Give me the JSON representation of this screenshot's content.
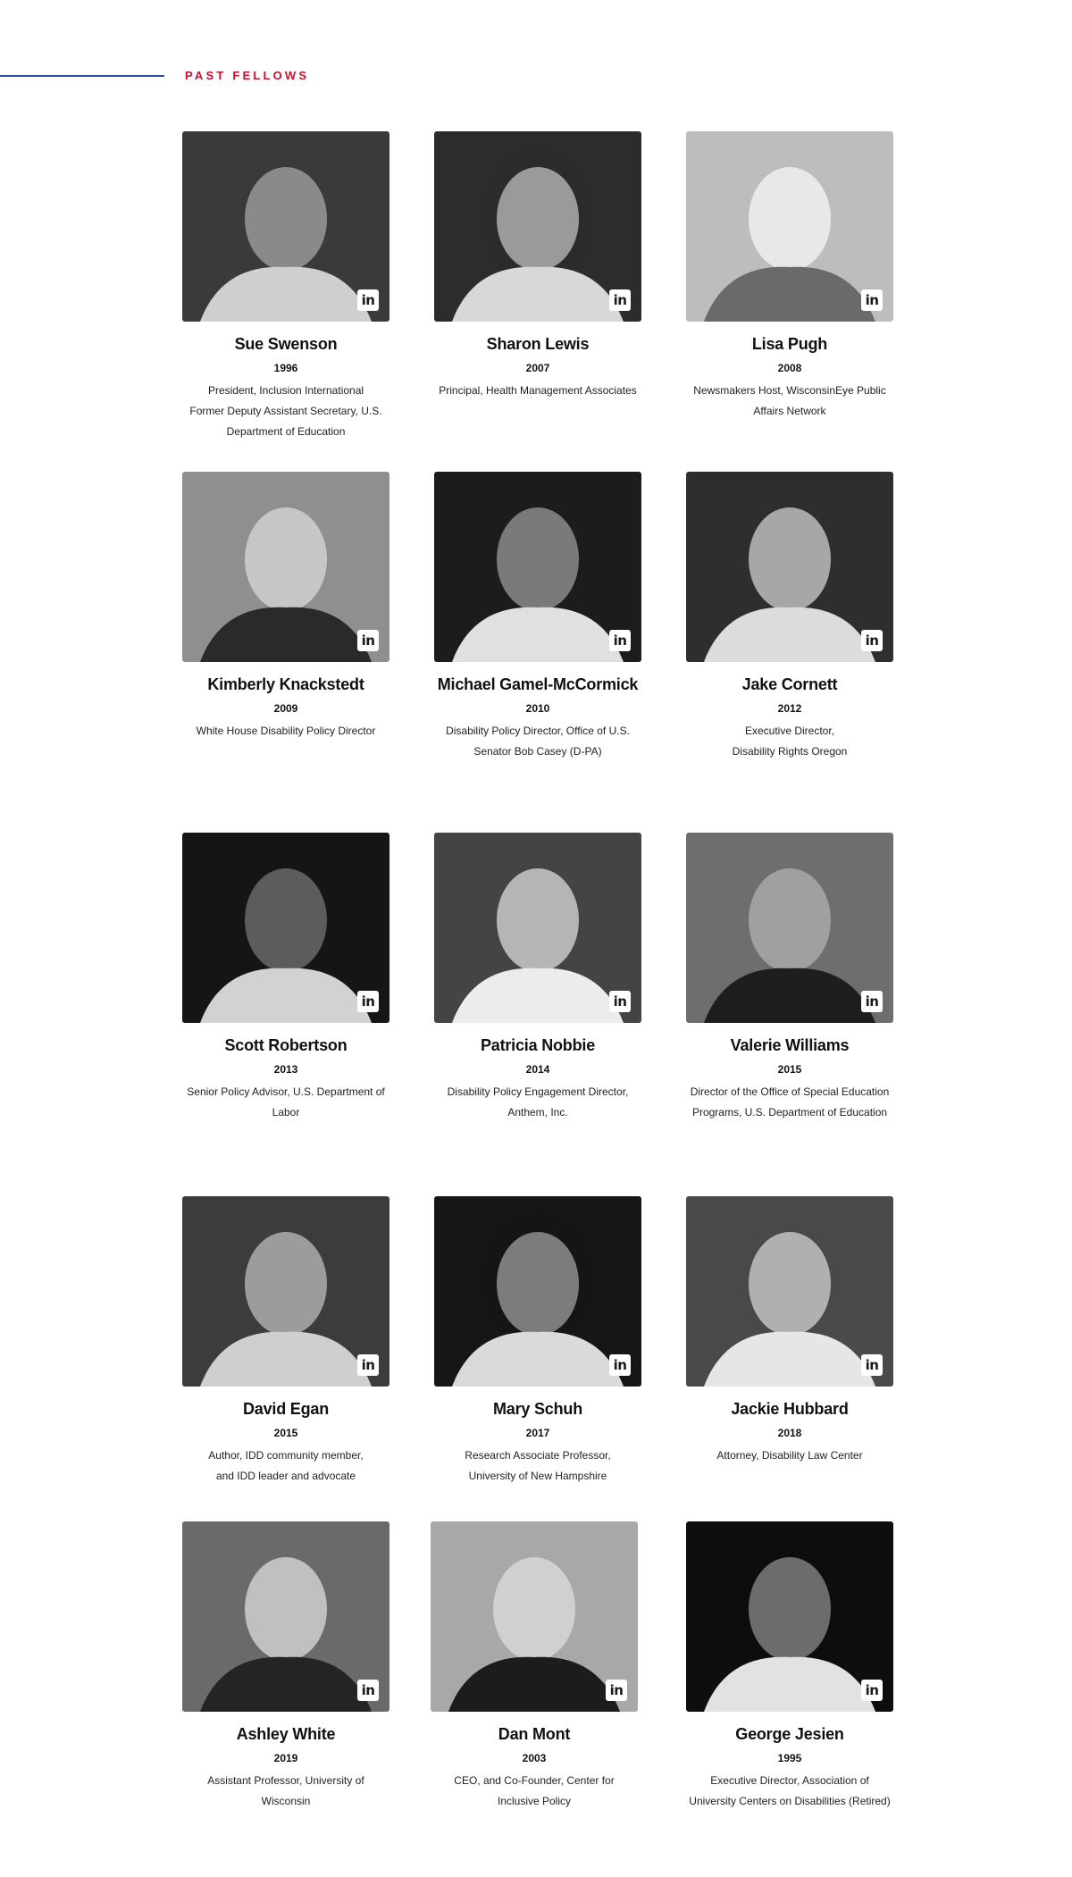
{
  "section": {
    "title": "PAST FELLOWS",
    "accent_color": "#c8102e",
    "line_color": "#2b4aa0"
  },
  "social_icon": {
    "name": "linkedin-icon",
    "glyph": "in"
  },
  "fellows": [
    {
      "name": "Sue Swenson",
      "year": "1996",
      "role": [
        "President, Inclusion International",
        "Former Deputy Assistant Secretary, U.S.",
        "Department of Education"
      ]
    },
    {
      "name": "Sharon Lewis",
      "year": "2007",
      "role": [
        "Principal, Health Management Associates"
      ]
    },
    {
      "name": "Lisa Pugh",
      "year": "2008",
      "role": [
        "Newsmakers Host, WisconsinEye Public",
        "Affairs Network"
      ]
    },
    {
      "name": "Kimberly Knackstedt",
      "year": "2009",
      "role": [
        "White House Disability Policy Director"
      ]
    },
    {
      "name": "Michael Gamel-McCormick",
      "year": "2010",
      "role": [
        "Disability Policy Director, Office of U.S.",
        "Senator Bob Casey (D-PA)"
      ]
    },
    {
      "name": "Jake Cornett",
      "year": "2012",
      "role": [
        "Executive Director,",
        "Disability Rights Oregon"
      ]
    },
    {
      "name": "Scott Robertson",
      "year": "2013",
      "role": [
        "Senior Policy Advisor, U.S. Department of",
        "Labor"
      ]
    },
    {
      "name": "Patricia Nobbie",
      "year": "2014",
      "role": [
        "Disability Policy Engagement Director,",
        "Anthem, Inc."
      ]
    },
    {
      "name": "Valerie Williams",
      "year": "2015",
      "role": [
        "Director of the Office of Special Education",
        "Programs, U.S. Department of Education"
      ]
    },
    {
      "name": "David Egan",
      "year": "2015",
      "role": [
        "Author, IDD community member,",
        "and IDD leader and advocate"
      ]
    },
    {
      "name": "Mary Schuh",
      "year": "2017",
      "role": [
        "Research Associate Professor,",
        "University of New Hampshire"
      ]
    },
    {
      "name": "Jackie Hubbard",
      "year": "2018",
      "role": [
        "Attorney, Disability Law Center"
      ]
    },
    {
      "name": "Ashley White",
      "year": "2019",
      "role": [
        "Assistant Professor, University of Wisconsin"
      ]
    },
    {
      "name": "Dan Mont",
      "year": "2003",
      "role": [
        "CEO, and Co-Founder, Center for",
        "Inclusive Policy"
      ]
    },
    {
      "name": "George Jesien",
      "year": "1995",
      "role": [
        "Executive Director, Association of",
        "University Centers on Disabilities (Retired)"
      ]
    }
  ]
}
